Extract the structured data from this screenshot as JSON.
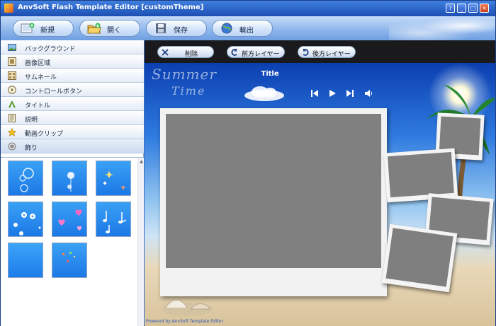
{
  "window": {
    "title": "AnvSoft Flash Template Editor [customTheme]",
    "controls": [
      "?",
      "_",
      "□",
      "×"
    ]
  },
  "toolbar": {
    "buttons": [
      {
        "label": "新規",
        "icon": "new-document-icon"
      },
      {
        "label": "開く",
        "icon": "open-folder-icon"
      },
      {
        "label": "保存",
        "icon": "save-disk-icon"
      },
      {
        "label": "輸出",
        "icon": "export-globe-icon"
      }
    ]
  },
  "sidebar": {
    "items": [
      {
        "label": "バックグラウンド",
        "icon": "background-icon"
      },
      {
        "label": "画像区域",
        "icon": "image-area-icon"
      },
      {
        "label": "サムネール",
        "icon": "thumbnail-icon"
      },
      {
        "label": "コントロールボタン",
        "icon": "control-button-icon"
      },
      {
        "label": "タイトル",
        "icon": "title-icon"
      },
      {
        "label": "説明",
        "icon": "description-icon"
      },
      {
        "label": "動画クリップ",
        "icon": "movie-clip-star-icon"
      },
      {
        "label": "飾り",
        "icon": "decoration-icon"
      }
    ],
    "selected_index": 7,
    "thumbnails": [
      {
        "name": "bubbles"
      },
      {
        "name": "dandelion"
      },
      {
        "name": "sparkles"
      },
      {
        "name": "flowers"
      },
      {
        "name": "hearts"
      },
      {
        "name": "music-notes"
      },
      {
        "name": "plain-blue"
      },
      {
        "name": "confetti"
      }
    ]
  },
  "editor_toolbar": {
    "delete_label": "削除",
    "bring_forward_label": "前方レイヤー",
    "send_backward_label": "後方レイヤー"
  },
  "stage": {
    "title": "Title",
    "decor_text_1": "Summer",
    "decor_text_2": "Time",
    "footer": "Powered by AnvSoft Template Editor",
    "player_controls": [
      "previous-icon",
      "play-icon",
      "next-icon",
      "volume-icon"
    ]
  },
  "colors": {
    "titlebar": "#1d4fb3",
    "toolbar": "#8fb7ec",
    "editor_bar": "#1a1a1c",
    "sky": "#2f7be0",
    "placeholder": "#808080"
  }
}
